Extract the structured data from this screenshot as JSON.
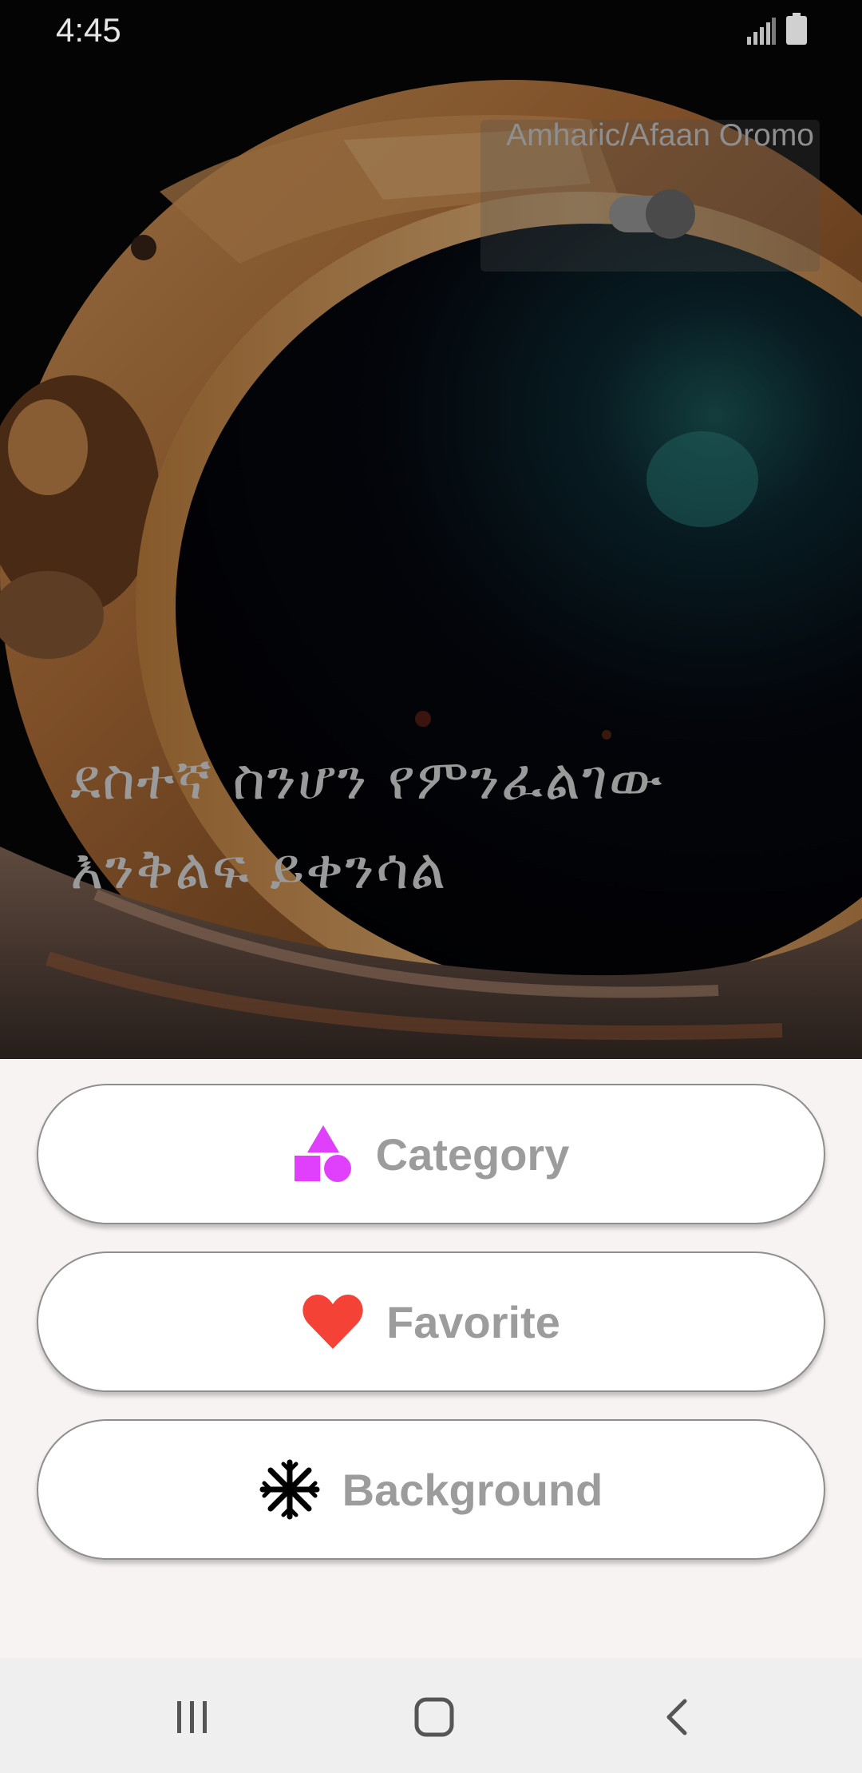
{
  "status_bar": {
    "time": "4:45",
    "icons": [
      "signal-icon",
      "battery-icon"
    ]
  },
  "hero": {
    "image": "astronaut-helmet-painting",
    "language_toggle": {
      "label": "Amharic/Afaan Oromo",
      "state": "on"
    },
    "quote_lines": [
      "ደስተኛ ስንሆን የምንፈልገው",
      "እንቅልፍ ይቀንሳል"
    ]
  },
  "menu": {
    "buttons": [
      {
        "label": "Category",
        "icon": "shapes-icon",
        "icon_color": "#e040fb"
      },
      {
        "label": "Favorite",
        "icon": "heart-icon",
        "icon_color": "#f44336"
      },
      {
        "label": "Background",
        "icon": "snowflake-icon",
        "icon_color": "#000000"
      }
    ]
  },
  "nav_bar": {
    "icons": [
      "recent-apps-icon",
      "home-icon",
      "back-icon"
    ]
  },
  "colors": {
    "panel_background": "#f7f3f2",
    "button_background": "#ffffff",
    "button_text": "#9c9c9c",
    "quote_text": "#9a9a9a"
  }
}
